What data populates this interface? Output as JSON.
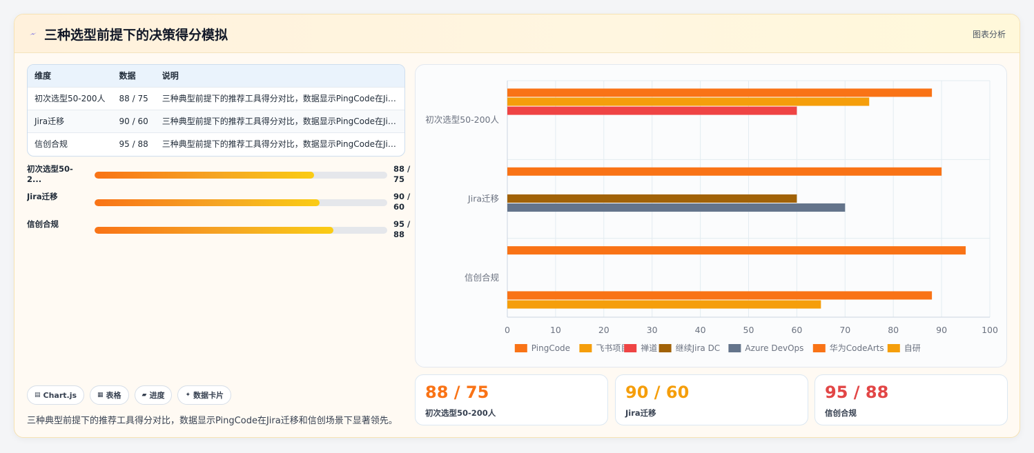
{
  "header": {
    "title": "三种选型前提下的决策得分模拟",
    "link": "图表分析"
  },
  "table": {
    "columns": [
      "维度",
      "数据",
      "说明"
    ],
    "rows": [
      [
        "初次选型50-200人",
        "88 / 75",
        "三种典型前提下的推荐工具得分对比，数据显示PingCode在Jira迁移和信创场景下显著领先。"
      ],
      [
        "Jira迁移",
        "90 / 60",
        "三种典型前提下的推荐工具得分对比，数据显示PingCode在Jira迁移和信创场景下显著领先。"
      ],
      [
        "信创合规",
        "95 / 88",
        "三种典型前提下的推荐工具得分对比，数据显示PingCode在Jira迁移和信创场景下显著领先。"
      ]
    ]
  },
  "progress": [
    {
      "label": "初次选型50-2...",
      "value": "88 / 75",
      "fraction": 0.75
    },
    {
      "label": "Jira迁移",
      "value": "90 / 60",
      "fraction": 0.77
    },
    {
      "label": "信创合规",
      "value": "95 / 88",
      "fraction": 0.815
    }
  ],
  "tags": [
    {
      "icon": "chart-icon",
      "glyph": "▤",
      "label": "Chart.js"
    },
    {
      "icon": "table-icon",
      "glyph": "▦",
      "label": "表格"
    },
    {
      "icon": "folder-icon",
      "glyph": "▰",
      "label": "进度"
    },
    {
      "icon": "sparkle-icon",
      "glyph": "✦",
      "label": "数据卡片"
    }
  ],
  "summary": "三种典型前提下的推荐工具得分对比，数据显示PingCode在Jira迁移和信创场景下显著领先。",
  "kpis": [
    {
      "value": "88 / 75",
      "label": "初次选型50-200人",
      "color": "#f97316"
    },
    {
      "value": "90 / 60",
      "label": "Jira迁移",
      "color": "#f59e0b"
    },
    {
      "value": "95 / 88",
      "label": "信创合规",
      "color": "#e24646"
    }
  ],
  "chart_data": {
    "type": "bar",
    "orientation": "horizontal",
    "categories": [
      "初次选型50-200人",
      "Jira迁移",
      "信创合规"
    ],
    "xlim": [
      0,
      100
    ],
    "x_ticks": [
      0,
      10,
      20,
      30,
      40,
      50,
      60,
      70,
      80,
      90,
      100
    ],
    "grid": true,
    "legend_position": "bottom",
    "series": [
      {
        "name": "PingCode",
        "color": "#f97316",
        "values": [
          88,
          90,
          95
        ]
      },
      {
        "name": "飞书项目",
        "color": "#f59e0b",
        "values": [
          75,
          null,
          null
        ]
      },
      {
        "name": "禅道",
        "color": "#ef4444",
        "values": [
          60,
          null,
          null
        ]
      },
      {
        "name": "继续Jira DC",
        "color": "#a16207",
        "values": [
          null,
          60,
          null
        ]
      },
      {
        "name": "Azure DevOps",
        "color": "#64748b",
        "values": [
          null,
          70,
          null
        ]
      },
      {
        "name": "华为CodeArts",
        "color": "#f97316",
        "values": [
          null,
          null,
          88
        ]
      },
      {
        "name": "自研",
        "color": "#f59e0b",
        "values": [
          null,
          null,
          65
        ]
      }
    ]
  }
}
